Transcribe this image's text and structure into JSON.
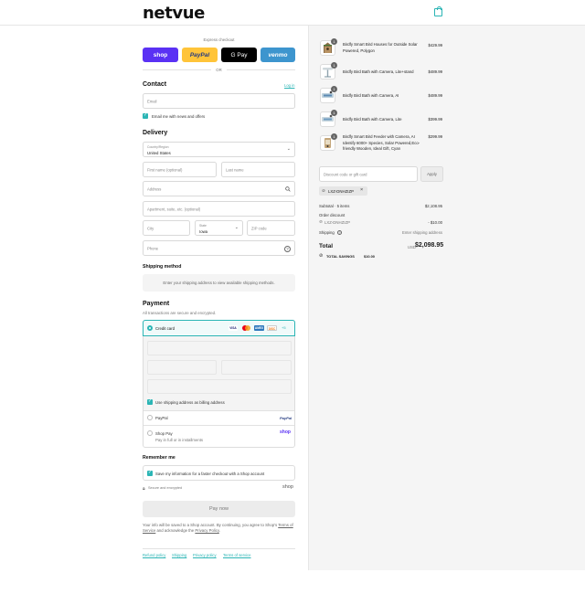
{
  "header": {
    "logo": "netvue",
    "cart_icon": "shopping-bag-icon"
  },
  "express": {
    "title": "Express checkout",
    "buttons": [
      {
        "label": "shop",
        "color": "#5a31f4"
      },
      {
        "label": "PayPal",
        "color": "#ffc439"
      },
      {
        "label": "G Pay",
        "color": "#000000"
      },
      {
        "label": "venmo",
        "color": "#3d95ce"
      }
    ],
    "or": "OR"
  },
  "contact": {
    "title": "Contact",
    "login": "Log in",
    "email_placeholder": "Email",
    "news_label": "Email me with news and offers",
    "news_checked": true
  },
  "delivery": {
    "title": "Delivery",
    "country_label": "Country/Region",
    "country_value": "United States",
    "first_name": "First name (optional)",
    "last_name": "Last name",
    "address": "Address",
    "apartment": "Apartment, suite, etc. (optional)",
    "city": "City",
    "state_label": "State",
    "state_value": "Iowa",
    "zip": "ZIP code",
    "phone": "Phone"
  },
  "shipping": {
    "title": "Shipping method",
    "message": "Enter your shipping address to view available shipping methods."
  },
  "payment": {
    "title": "Payment",
    "subtitle": "All transactions are secure and encrypted.",
    "credit_card_label": "Credit card",
    "card_logos": [
      "VISA",
      "MC",
      "AMEX",
      "DISC"
    ],
    "card_more": "+5",
    "billing_label": "Use shipping address as billing address",
    "paypal_label": "PayPal",
    "paypal_logo": "PayPal",
    "shoppay_label": "Shop Pay",
    "shoppay_sub": "Pay in full or in installments",
    "shoppay_logo": "shop"
  },
  "remember": {
    "title": "Remember me",
    "save_label": "Save my information for a faster checkout with a Shop account",
    "secure": "Secure and encrypted",
    "shop_logo": "shop"
  },
  "pay_button": "Pay now",
  "legal": {
    "prefix": "Your info will be saved to a Shop account. By continuing, you agree to Shop's",
    "terms": "Terms of Service",
    "middle": "and acknowledge the",
    "privacy": "Privacy Policy",
    "suffix": "."
  },
  "footer_links": [
    "Refund policy",
    "Shipping",
    "Privacy policy",
    "Terms of service"
  ],
  "order": {
    "items": [
      {
        "qty": "1",
        "name": "Birdfy Smart Bird Houses for Outside Solar Powered, Polygon",
        "price": "$429.99",
        "thumb_icon": "bird-house-icon"
      },
      {
        "qty": "1",
        "name": "Birdfy Bird Bath with Camera, Lite+stand",
        "price": "$489.99",
        "thumb_icon": "bird-bath-stand-icon"
      },
      {
        "qty": "1",
        "name": "Birdfy Bird Bath with Camera, AI",
        "price": "$489.99",
        "thumb_icon": "bird-bath-icon"
      },
      {
        "qty": "1",
        "name": "Birdfy Bird Bath with Camera, Lite",
        "price": "$399.99",
        "thumb_icon": "bird-bath-icon"
      },
      {
        "qty": "1",
        "name": "Birdfy Smart Bird Feeder with Camera, AI Identify 6000+ Species, Solar Powered,Eco-friendly Wooden, Ideal Gift, Cyan",
        "price": "$299.99",
        "thumb_icon": "bird-feeder-icon"
      }
    ],
    "discount_placeholder": "Discount code or gift card",
    "apply": "Apply",
    "code_chip": "LXZ-DNHZIZP",
    "subtotal_label": "Subtotal · 5 items",
    "subtotal_value": "$2,108.95",
    "order_discount_label": "Order discount",
    "discount_code": "LXZ-DNHZIZP",
    "discount_value": "- $10.00",
    "shipping_label": "Shipping",
    "shipping_value": "Enter shipping address",
    "total_label": "Total",
    "currency": "USD",
    "total_value": "$2,098.95",
    "savings_label": "TOTAL SAVINGS",
    "savings_value": "$10.00"
  },
  "colors": {
    "accent": "#2bb5b5",
    "panel": "#f5f5f5"
  }
}
